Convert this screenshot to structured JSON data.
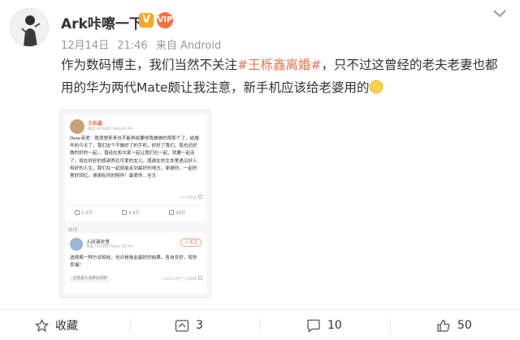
{
  "author": {
    "name": "Ark咔嚓一下",
    "verified_badge": "V",
    "vip_badge": "VIP"
  },
  "meta": {
    "date": "12月14日",
    "time": "21:46",
    "source": "来自 Android"
  },
  "content": {
    "part1": "作为数码博主，我们当然不关注",
    "hashtag": "#王栎鑫离婚#",
    "part2": "，只不过这曾经的老夫老妻也都用的华为两代Mate颇让我注意，新手机应该给老婆用的"
  },
  "embedded": {
    "card1": {
      "name": "王栎鑫",
      "meta": "来自 HUAWEI Mate30 Pro",
      "text": "Dear亲爱：我很想来来也不能再给要他我做做的那那个了。结婚年的今天了，我们这个不做好了的手机，好好了我们，我也还好做的好的一起。，曾经在和大家一起让我们在一起，就要一起走了。现在好好的感谢两位可爱的女儿。感谢在的生命里遇见好人和好的人生，我们在一起就能走到最好的地方。谢谢你，一起的美好回忆。谢谢有你的陪伴！最爱你…全文",
      "hint": "2个小时前",
      "repost_count": "1.5万",
      "comment_count": "3.9万",
      "like_count": "20万"
    },
    "section_label": "热评",
    "card2": {
      "name": "人间清欢里",
      "meta": "来自 HUAWEI Mate 30 Pro",
      "follow": "+ 关注",
      "text": "选择换一种方式相处，也许是彼此最好的结果。各自安好，祝你幸福！",
      "tag": "已有多人为评论点赞",
      "hint": "1000人评论了该微博"
    }
  },
  "actions": {
    "favorite": "收藏",
    "repost": "3",
    "comment": "10",
    "like": "50"
  },
  "colors": {
    "hashtag": "#eb7350",
    "meta": "#999999",
    "badge_v": "#f7a823"
  }
}
